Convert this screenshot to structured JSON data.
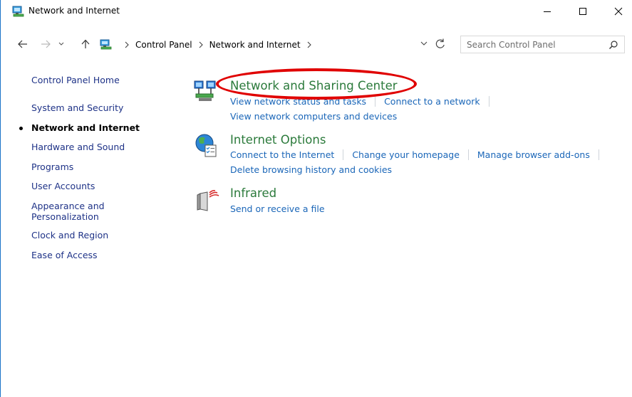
{
  "window": {
    "title": "Network and Internet",
    "controls": {
      "minimize": "minimize",
      "maximize": "maximize",
      "close": "close"
    }
  },
  "address": {
    "breadcrumbs": [
      "Control Panel",
      "Network and Internet"
    ],
    "search_placeholder": "Search Control Panel"
  },
  "sidebar": {
    "items": [
      {
        "label": "Control Panel Home",
        "active": false
      },
      {
        "label": "System and Security",
        "active": false
      },
      {
        "label": "Network and Internet",
        "active": true
      },
      {
        "label": "Hardware and Sound",
        "active": false
      },
      {
        "label": "Programs",
        "active": false
      },
      {
        "label": "User Accounts",
        "active": false
      },
      {
        "label": "Appearance and",
        "label2": "Personalization",
        "active": false
      },
      {
        "label": "Clock and Region",
        "active": false
      },
      {
        "label": "Ease of Access",
        "active": false
      }
    ]
  },
  "categories": [
    {
      "title": "Network and Sharing Center",
      "icon": "network-sharing-icon",
      "links_row1": [
        "View network status and tasks",
        "Connect to a network"
      ],
      "links_row2": [
        "View network computers and devices"
      ]
    },
    {
      "title": "Internet Options",
      "icon": "internet-options-icon",
      "links_row1": [
        "Connect to the Internet",
        "Change your homepage",
        "Manage browser add-ons"
      ],
      "links_row2": [
        "Delete browsing history and cookies"
      ]
    },
    {
      "title": "Infrared",
      "icon": "infrared-icon",
      "links_row1": [
        "Send or receive a file"
      ]
    }
  ],
  "colors": {
    "link": "#1a66b8",
    "category_title": "#2b7a3b",
    "sidebar_link": "#1e3287",
    "highlight": "#e00000"
  }
}
